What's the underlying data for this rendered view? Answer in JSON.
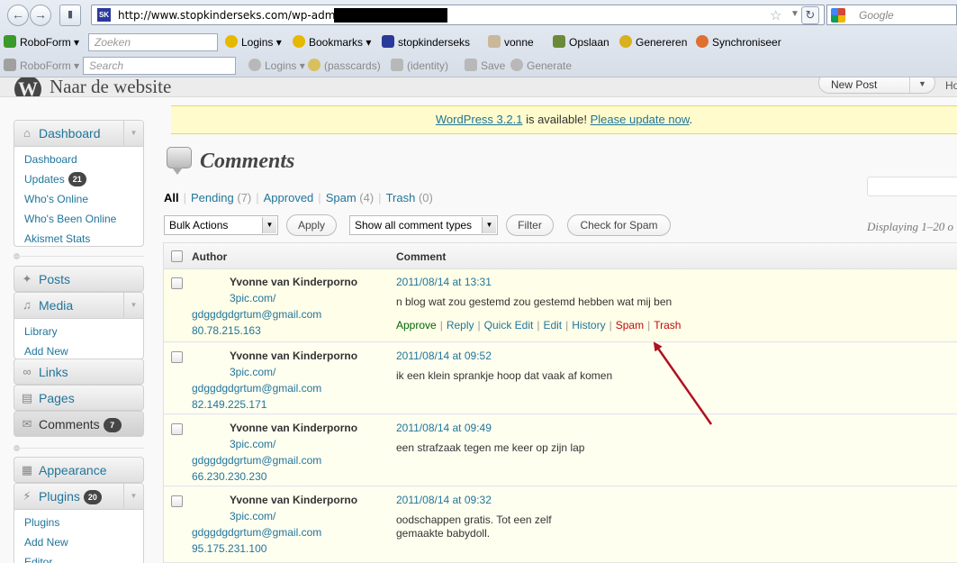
{
  "browser": {
    "url": "http://www.stopkinderseks.com/wp-admin/e",
    "search_placeholder": "Google"
  },
  "toolbar1": {
    "roboform": "RoboForm",
    "search_placeholder": "Zoeken",
    "items": [
      "Logins",
      "Bookmarks",
      "stopkinderseks",
      "vonne",
      "Opslaan",
      "Genereren",
      "Synchroniseer"
    ]
  },
  "toolbar2": {
    "roboform": "RoboForm",
    "search_placeholder": "Search",
    "items": [
      "Logins",
      "(passcards)",
      "(identity)",
      "Save",
      "Generate"
    ]
  },
  "wp_header": {
    "site_name": "Naar de website",
    "favorite_action": "New Post",
    "howdy": "Ho"
  },
  "sidebar": {
    "dashboard": {
      "label": "Dashboard",
      "items": [
        "Dashboard",
        "Updates",
        "Who's Online",
        "Who's Been Online",
        "Akismet Stats"
      ],
      "updates_count": "21"
    },
    "posts": "Posts",
    "media": {
      "label": "Media",
      "items": [
        "Library",
        "Add New"
      ]
    },
    "links": "Links",
    "pages": "Pages",
    "comments": {
      "label": "Comments",
      "count": "7"
    },
    "appearance": "Appearance",
    "plugins": {
      "label": "Plugins",
      "count": "20",
      "items": [
        "Plugins",
        "Add New",
        "Editor"
      ]
    }
  },
  "notice": {
    "link1": "WordPress 3.2.1",
    "middle": " is available! ",
    "link2": "Please update now",
    "end": "."
  },
  "page": {
    "title": "Comments",
    "filters": {
      "all": "All",
      "pending": "Pending",
      "pending_count": "(7)",
      "approved": "Approved",
      "spam": "Spam",
      "spam_count": "(4)",
      "trash": "Trash",
      "trash_count": "(0)"
    },
    "bulk_actions": "Bulk Actions",
    "apply": "Apply",
    "comment_types": "Show all comment types",
    "filter": "Filter",
    "check_spam": "Check for Spam",
    "displaying": "Displaying 1–20 o"
  },
  "table": {
    "col_author": "Author",
    "col_comment": "Comment",
    "rows": [
      {
        "author": "Yvonne van Kinderporno",
        "url": "3pic.com/",
        "email": "gdggdgdgrtum@gmail.com",
        "ip": "80.78.215.163",
        "date": "2011/08/14 at 13:31",
        "text": "n blog wat zou gestemd zou gestemd hebben wat mij ben"
      },
      {
        "author": "Yvonne van Kinderporno",
        "url": "3pic.com/",
        "email": "gdggdgdgrtum@gmail.com",
        "ip": "82.149.225.171",
        "date": "2011/08/14 at 09:52",
        "text": "ik een klein sprankje hoop dat vaak af komen"
      },
      {
        "author": "Yvonne van Kinderporno",
        "url": "3pic.com/",
        "email": "gdggdgdgrtum@gmail.com",
        "ip": "66.230.230.230",
        "date": "2011/08/14 at 09:49",
        "text": "een strafzaak tegen me keer op zijn lap"
      },
      {
        "author": "Yvonne van Kinderporno",
        "url": "3pic.com/",
        "email": "gdggdgdgrtum@gmail.com",
        "ip": "95.175.231.100",
        "date": "2011/08/14 at 09:32",
        "text": "oodschappen gratis. Tot een zelf",
        "text2": "gemaakte babydoll."
      }
    ],
    "actions": [
      "Approve",
      "Reply",
      "Quick Edit",
      "Edit",
      "History",
      "Spam",
      "Trash"
    ]
  },
  "colors": {
    "link": "#21759b",
    "spam": "#bc0b0b",
    "approve": "#006505",
    "notice_bg": "#fffbcc",
    "arrow": "#b01020"
  }
}
